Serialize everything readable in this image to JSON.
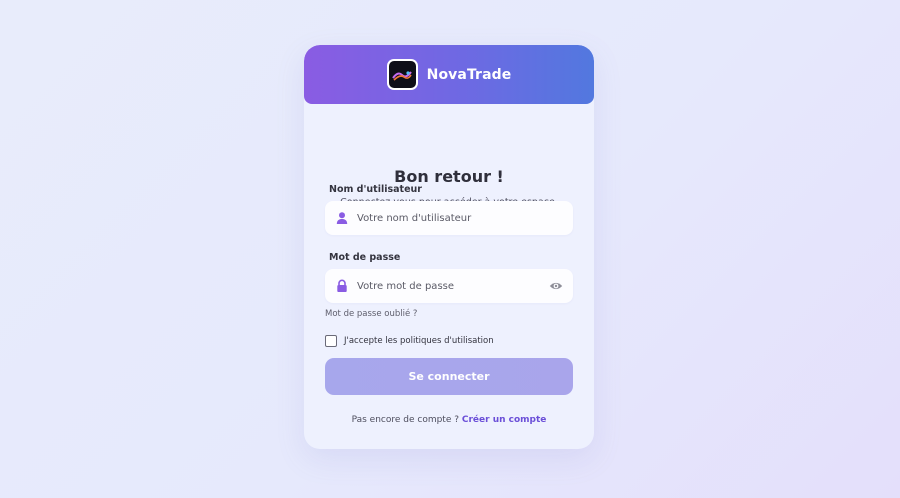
{
  "brand": {
    "name": "NovaTrade",
    "logo_icon": "novatrade-logo"
  },
  "header": {
    "title": "Bon retour !",
    "subtitle": "Connectez-vous pour accéder à votre espace."
  },
  "username": {
    "label": "Nom d'utilisateur",
    "placeholder": "Votre nom d'utilisateur",
    "value": "",
    "icon": "user-icon"
  },
  "password": {
    "label": "Mot de passe",
    "placeholder": "Votre mot de passe",
    "value": "",
    "icon": "lock-icon",
    "toggle_icon": "eye-icon"
  },
  "forgot_password": "Mot de passe oublié ?",
  "terms": {
    "label": "J'accepte les politiques d'utilisation",
    "checked": false
  },
  "submit_label": "Se connecter",
  "signup": {
    "prompt": "Pas encore de compte ?",
    "link": "Créer un compte"
  },
  "colors": {
    "header_start": "#8a5ce3",
    "header_end": "#5278df",
    "accent": "#8a5ce3",
    "link": "#6b4fd8",
    "button": "#a7a7ec"
  }
}
